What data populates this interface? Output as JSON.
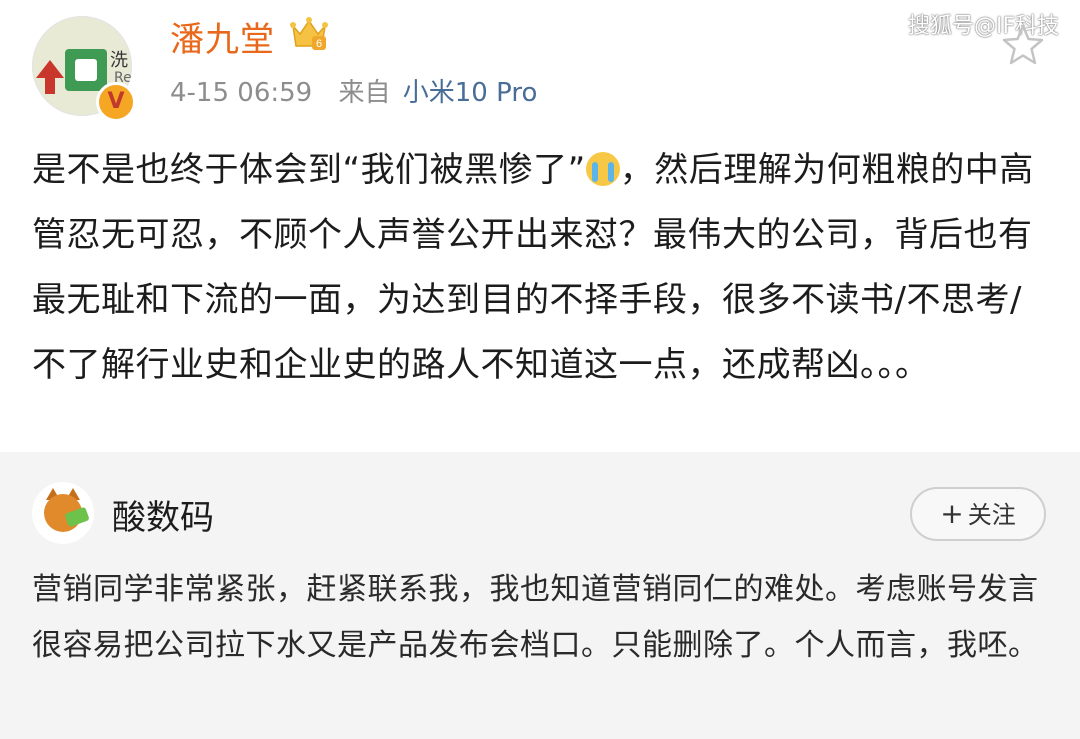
{
  "post": {
    "username": "潘九堂",
    "crown_badge": "6",
    "time": "4-15 06:59",
    "from_label": "来自",
    "device": "小米10 Pro",
    "text_part1": "是不是也终于体会到“我们被黑惨了”",
    "emoji": "crying-face",
    "text_part2": "，然后理解为何粗粮的中高管忍无可忍，不顾个人声誉公开出来怼？最伟大的公司，背后也有最无耻和下流的一面，为达到目的不择手段，很多不读书/不思考/不了解行业史和企业史的路人不知道这一点，还成帮凶。。。",
    "avatar_sign_char": "洗",
    "avatar_sign_char2": "Re",
    "verified_badge": "V"
  },
  "watermark": "搜狐号@IF科技",
  "repost": {
    "username": "酸数码",
    "follow_label": "关注",
    "follow_plus": "+",
    "text": "营销同学非常紧张，赶紧联系我，我也知道营销同仁的难处。考虑账号发言很容易把公司拉下水又是产品发布会档口。只能删除了。个人而言，我呸。"
  },
  "colors": {
    "username": "#e8691b",
    "device_link": "#486d97",
    "meta_gray": "#8d8d8d",
    "repost_bg": "#f4f4f4"
  }
}
